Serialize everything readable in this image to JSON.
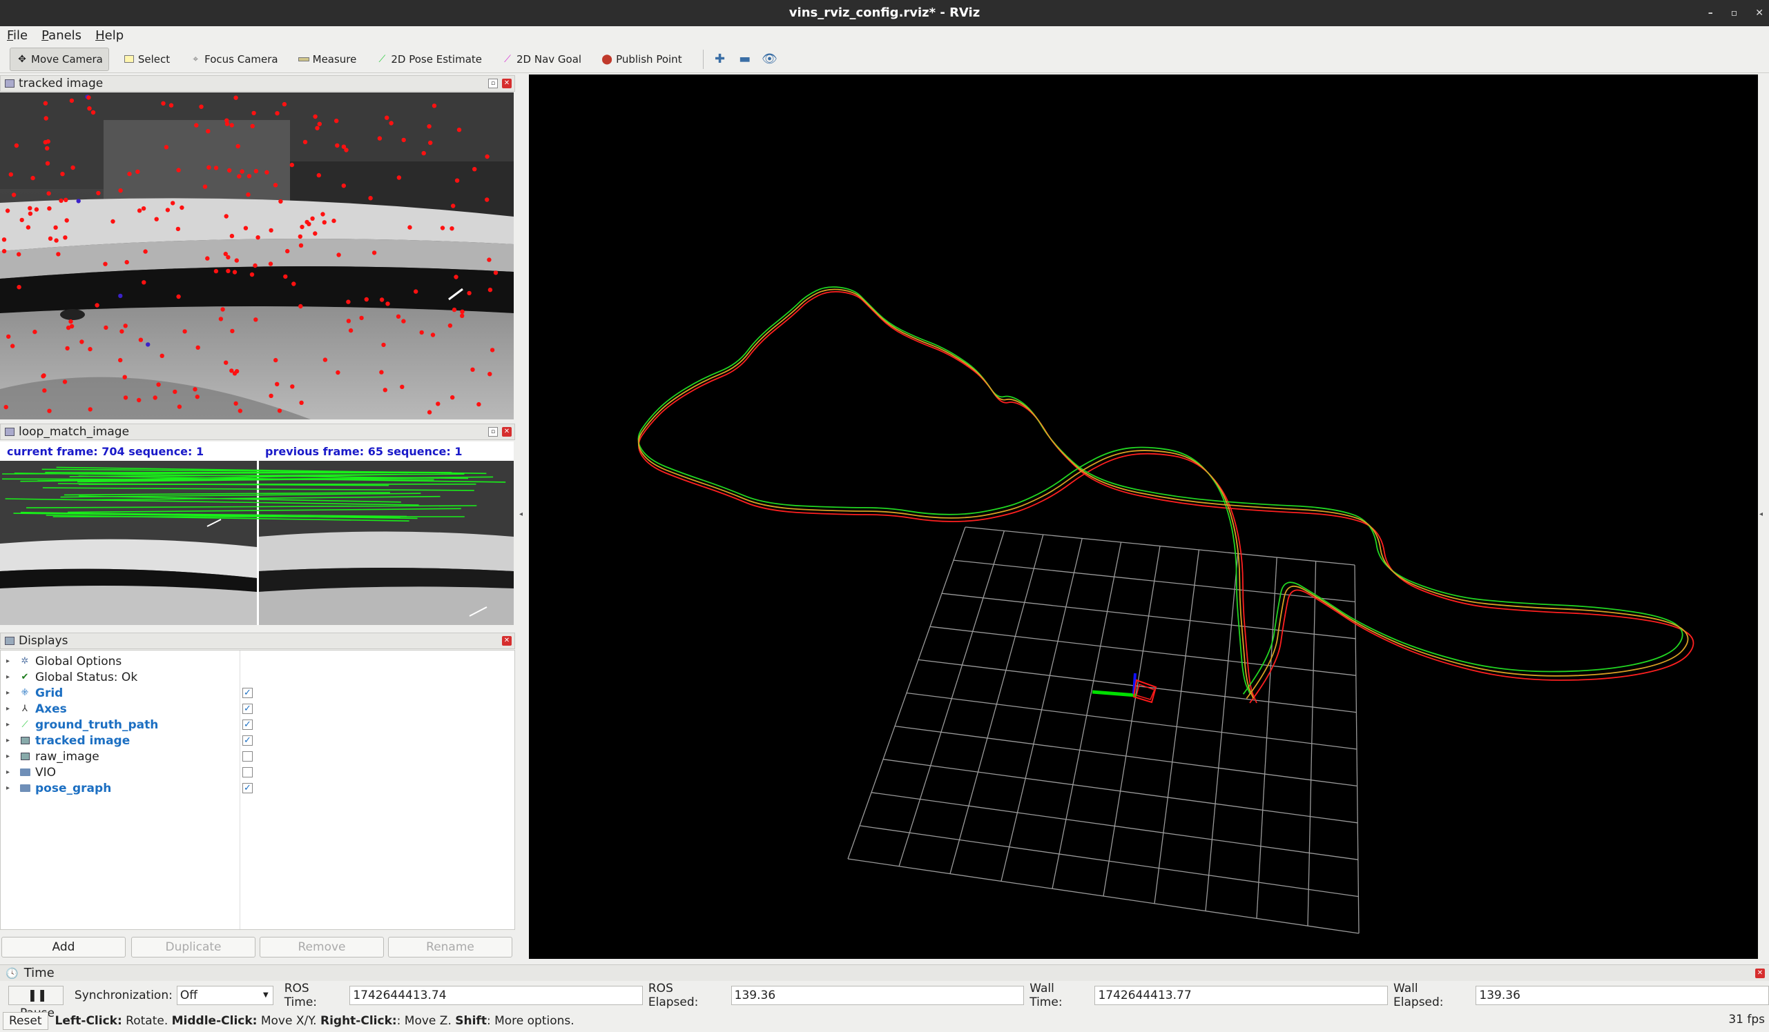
{
  "window": {
    "title": "vins_rviz_config.rviz* - RViz",
    "controls": [
      "–",
      "▫",
      "✕"
    ]
  },
  "menu": [
    "File",
    "Panels",
    "Help"
  ],
  "toolbar": {
    "tools": [
      {
        "label": "Move Camera",
        "icon": "move-camera-icon",
        "active": true
      },
      {
        "label": "Select",
        "icon": "select-icon"
      },
      {
        "label": "Focus Camera",
        "icon": "focus-camera-icon"
      },
      {
        "label": "Measure",
        "icon": "measure-icon"
      },
      {
        "label": "2D Pose Estimate",
        "icon": "pose-estimate-icon",
        "color": "#2ecc40"
      },
      {
        "label": "2D Nav Goal",
        "icon": "nav-goal-icon",
        "color": "#d633d6"
      },
      {
        "label": "Publish Point",
        "icon": "publish-point-icon",
        "color": "#c0392b"
      }
    ]
  },
  "panels": {
    "tracked_image": {
      "title": "tracked image"
    },
    "loop_match": {
      "title": "loop_match_image",
      "current": "current frame: 704  sequence: 1",
      "previous": "previous frame: 65  sequence: 1"
    },
    "displays": {
      "title": "Displays",
      "items": [
        {
          "label": "Global Options",
          "icon": "gear-icon",
          "enabled": false,
          "checkbox": null
        },
        {
          "label": "Global Status: Ok",
          "icon": "check-icon",
          "enabled": false,
          "checkbox": null
        },
        {
          "label": "Grid",
          "icon": "grid-icon",
          "enabled": true,
          "checkbox": true
        },
        {
          "label": "Axes",
          "icon": "axes-icon",
          "enabled": true,
          "checkbox": true
        },
        {
          "label": "ground_truth_path",
          "icon": "path-icon",
          "enabled": true,
          "checkbox": true
        },
        {
          "label": "tracked image",
          "icon": "image-icon",
          "enabled": true,
          "checkbox": true
        },
        {
          "label": "raw_image",
          "icon": "image-icon",
          "enabled": false,
          "checkbox": false
        },
        {
          "label": "VIO",
          "icon": "folder-icon",
          "enabled": false,
          "checkbox": false
        },
        {
          "label": "pose_graph",
          "icon": "folder-icon",
          "enabled": true,
          "checkbox": true
        }
      ],
      "buttons": [
        "Add",
        "Duplicate",
        "Remove",
        "Rename"
      ]
    }
  },
  "time": {
    "title": "Time",
    "pause_label": "Pause",
    "sync_label": "Synchronization:",
    "sync_value": "Off",
    "ros_time_label": "ROS Time:",
    "ros_time": "1742644413.74",
    "ros_elapsed_label": "ROS Elapsed:",
    "ros_elapsed": "139.36",
    "wall_time_label": "Wall Time:",
    "wall_time": "1742644413.77",
    "wall_elapsed_label": "Wall Elapsed:",
    "wall_elapsed": "139.36"
  },
  "status": {
    "reset_label": "Reset",
    "hint_left": "Left-Click:",
    "hint_left_text": " Rotate. ",
    "hint_middle": "Middle-Click:",
    "hint_middle_text": " Move X/Y. ",
    "hint_right": "Right-Click:",
    "hint_right_text": ": Move Z. ",
    "hint_shift": "Shift",
    "hint_shift_text": ": More options.",
    "fps": "31 fps"
  }
}
